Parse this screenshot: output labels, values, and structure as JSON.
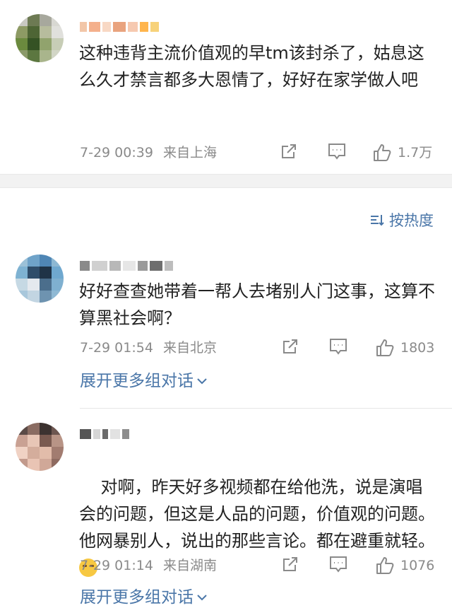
{
  "comments": [
    {
      "text": "这种违背主流价值观的早tm该封杀了，姑息这么久才禁言都多大恩情了，好好在家学做人吧",
      "time": "7-29 00:39",
      "location": "来自上海",
      "likes": "1.7万"
    },
    {
      "text": "好好查查她带着一帮人去堵别人门这事，这算不算黑社会啊？",
      "time": "7-29 01:54",
      "location": "来自北京",
      "likes": "1803",
      "expand": "展开更多组对话"
    },
    {
      "text": "对啊，昨天好多视频都在给他洗，说是演唱会的问题，但这是人品的问题，价值观的问题。他网暴别人，说出的那些言论。都在避重就轻。",
      "emoji": "laugh-cry-emoji",
      "time": "7-29 01:14",
      "location": "来自湖南",
      "likes": "1076",
      "expand": "展开更多组对话"
    }
  ],
  "sort": {
    "label": "按热度"
  },
  "colors": {
    "link": "#4a76a8",
    "meta": "#8a8a8a",
    "text": "#222222"
  },
  "icons": [
    "share-icon",
    "comment-icon",
    "like-icon",
    "sort-icon",
    "chevron-down-icon"
  ]
}
